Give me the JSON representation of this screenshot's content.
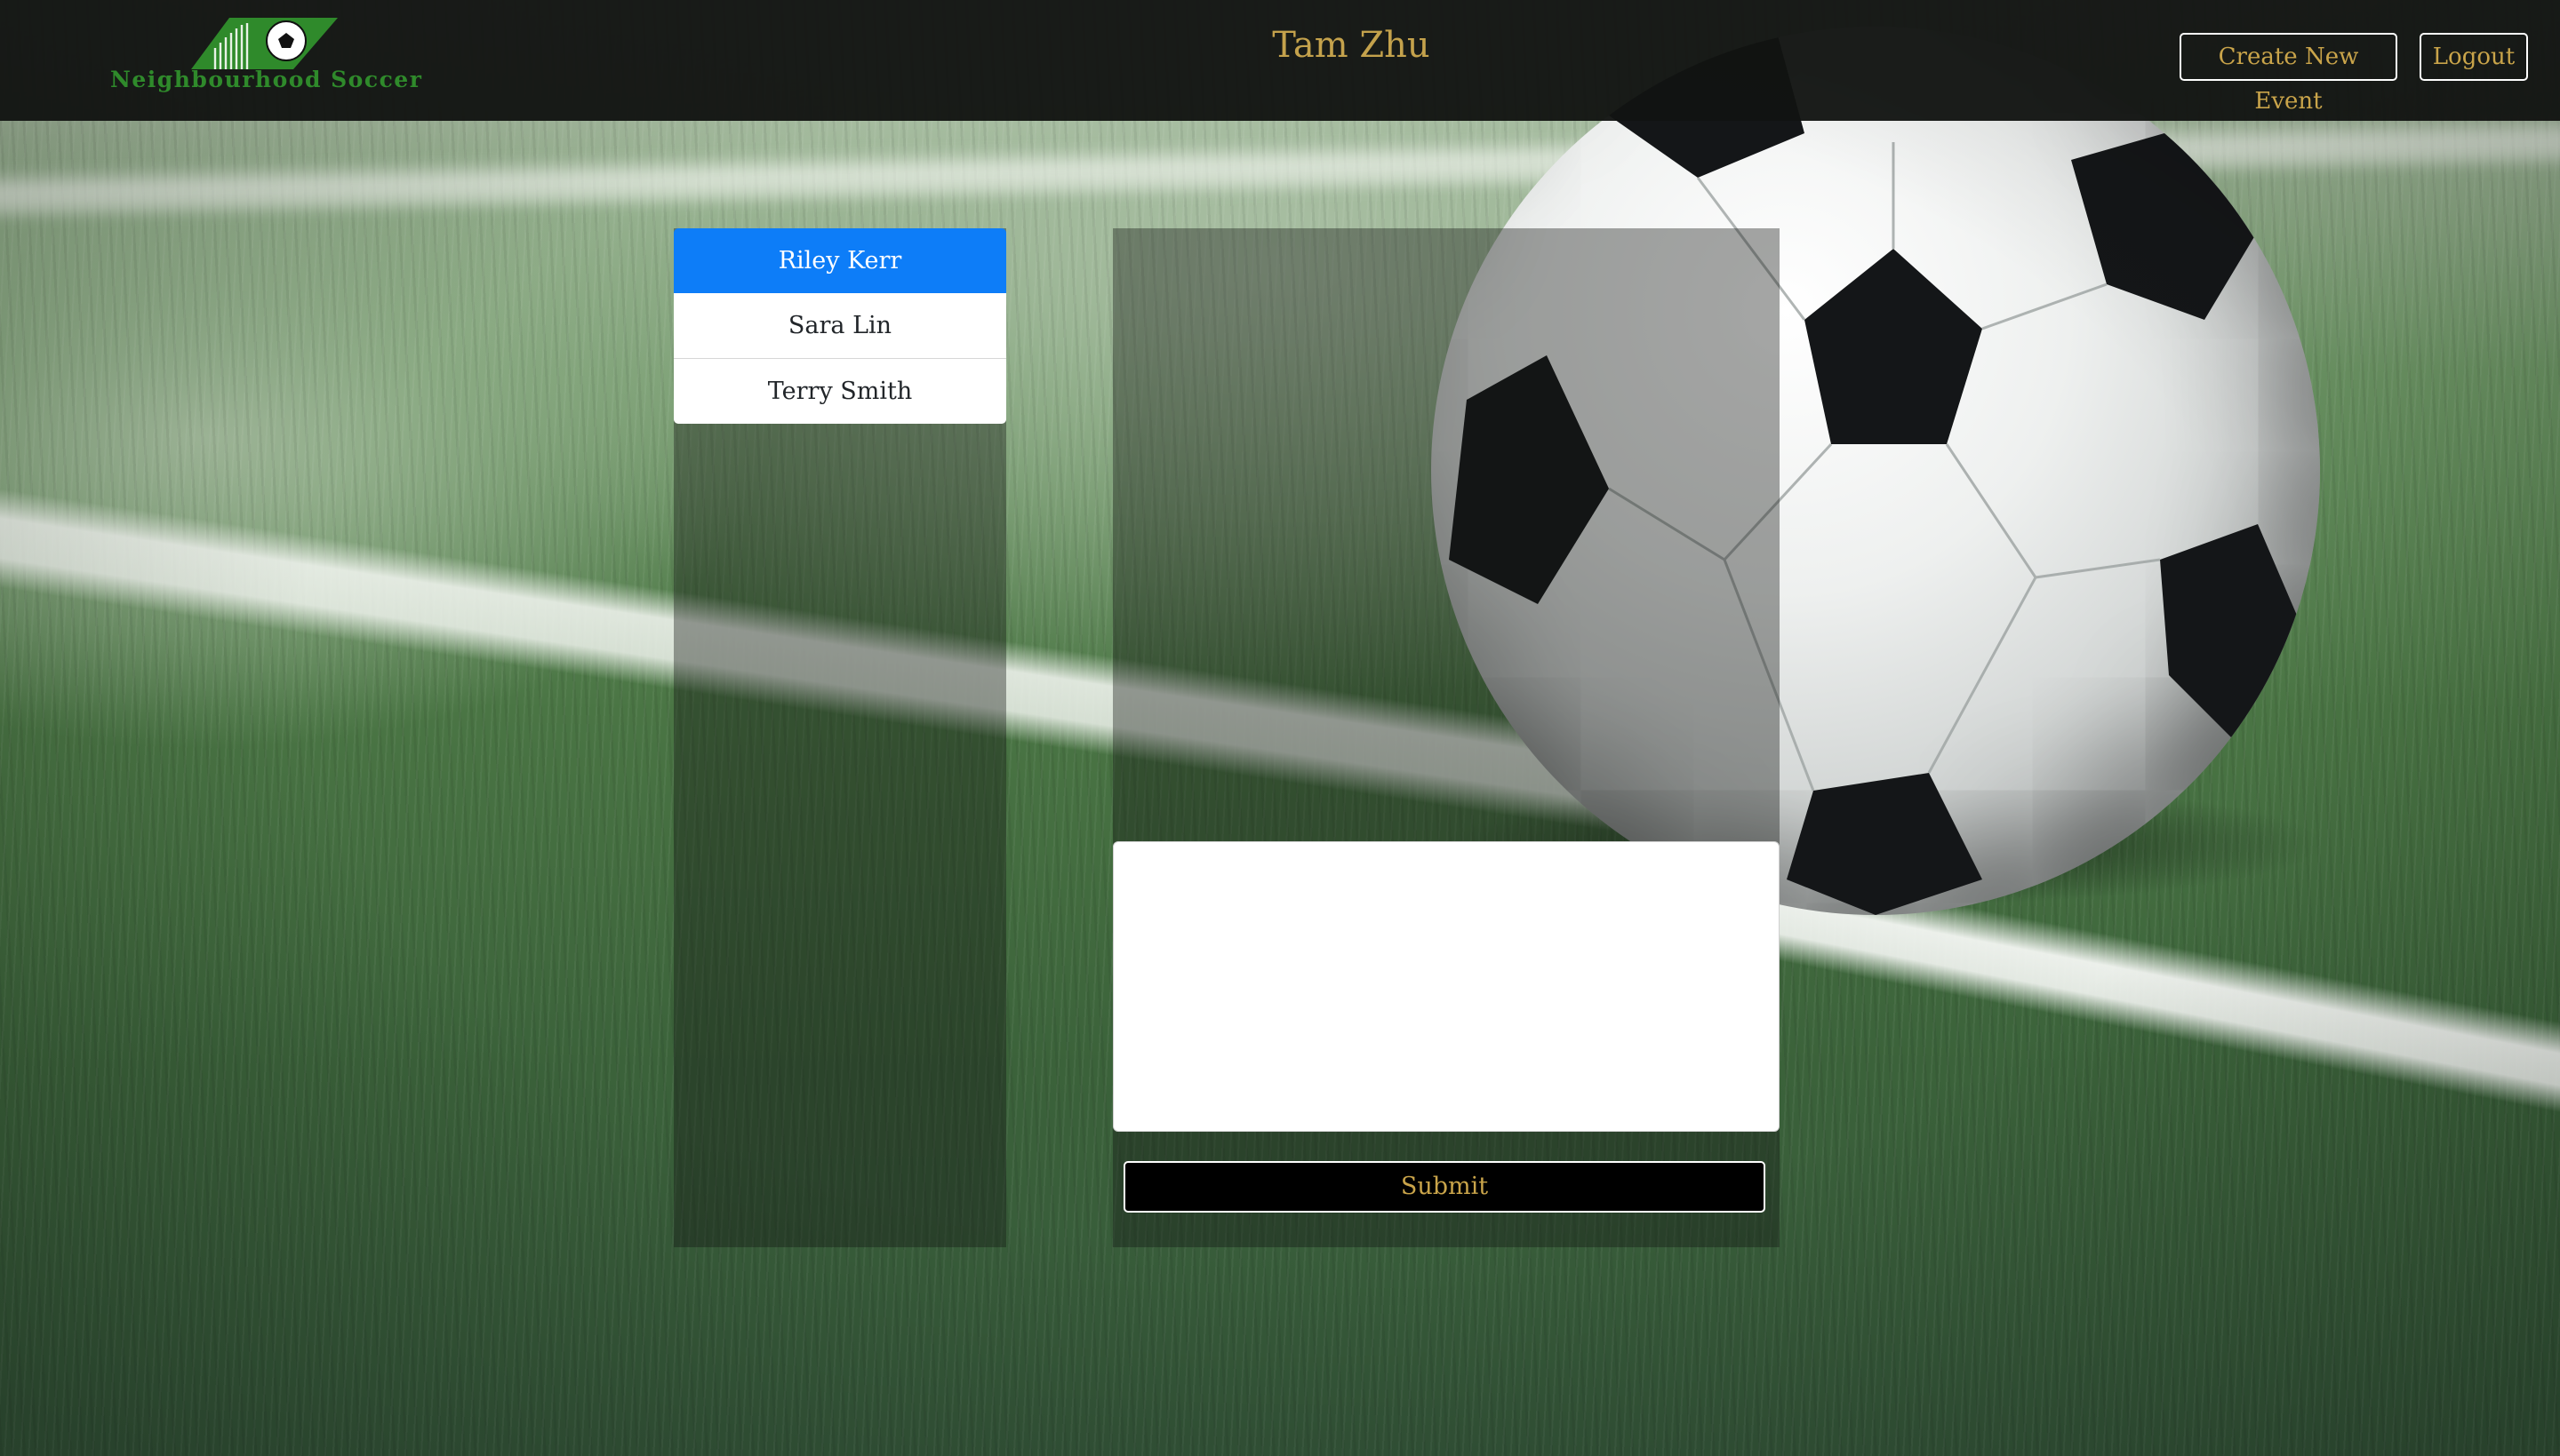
{
  "header": {
    "brand_name": "Neighbourhood Soccer",
    "user_name": "Tam Zhu",
    "create_event_label": "Create New Event",
    "logout_label": "Logout"
  },
  "members": {
    "items": [
      {
        "name": "Riley Kerr",
        "active": true
      },
      {
        "name": "Sara Lin",
        "active": false
      },
      {
        "name": "Terry Smith",
        "active": false
      }
    ]
  },
  "chat": {
    "message_value": "",
    "submit_label": "Submit"
  },
  "colors": {
    "navbar_bg": "#121412",
    "accent_gold": "#c4a24c",
    "brand_green": "#2f8a2b",
    "active_item_blue": "#0d7df8",
    "submit_bg": "#000000"
  },
  "icons": {
    "brand_logo": "soccer-ball-logo-icon"
  }
}
